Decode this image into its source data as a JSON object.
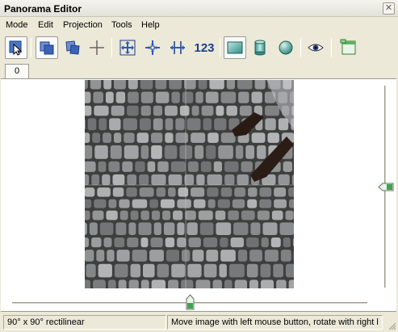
{
  "window": {
    "title": "Panorama Editor",
    "close_glyph": "✕"
  },
  "menu": [
    "Mode",
    "Edit",
    "Projection",
    "Tools",
    "Help"
  ],
  "toolbar": {
    "icons": [
      "select-arrow-icon",
      "move-image-icon",
      "move-image-alt-icon",
      "crosshair-icon",
      "fit-all-icon",
      "center-image-icon",
      "fit-width-icon",
      "number-text",
      "rectilinear-projection-icon",
      "cylindrical-projection-icon",
      "spherical-projection-icon",
      "eye-preview-icon",
      "window-layout-icon"
    ],
    "number_label": "123"
  },
  "tabs": [
    "0"
  ],
  "sliders": {
    "vertical_position": 0.5,
    "horizontal_position": 0.5
  },
  "status": {
    "fov": "90° x 90° rectilinear",
    "hint": "Move image with left mouse button, rotate with right l"
  },
  "colors": {
    "accent": "#2a6fb3",
    "slider_green": "#3fa34d"
  }
}
